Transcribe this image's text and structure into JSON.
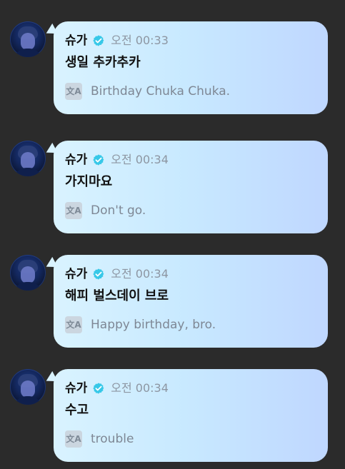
{
  "messages": [
    {
      "author": "슈가",
      "time": "오전 00:33",
      "text": "생일 추카추카",
      "translation": "Birthday Chuka Chuka.",
      "verified_icon": "verified-badge-icon",
      "translate_icon": "translate-icon"
    },
    {
      "author": "슈가",
      "time": "오전 00:34",
      "text": "가지마요",
      "translation": "Don't go.",
      "verified_icon": "verified-badge-icon",
      "translate_icon": "translate-icon"
    },
    {
      "author": "슈가",
      "time": "오전 00:34",
      "text": "해피 벌스데이 브로",
      "translation": "Happy birthday, bro.",
      "verified_icon": "verified-badge-icon",
      "translate_icon": "translate-icon"
    },
    {
      "author": "슈가",
      "time": "오전 00:34",
      "text": "수고",
      "translation": "trouble",
      "verified_icon": "verified-badge-icon",
      "translate_icon": "translate-icon"
    }
  ],
  "translate_glyph": "文A",
  "colors": {
    "background": "#2b2b2b",
    "bubble_start": "#d9f3ff",
    "bubble_end": "#bfd7ff",
    "verified": "#37c8e8",
    "time_text": "#8d96a2",
    "translated_text": "#7e8794"
  }
}
